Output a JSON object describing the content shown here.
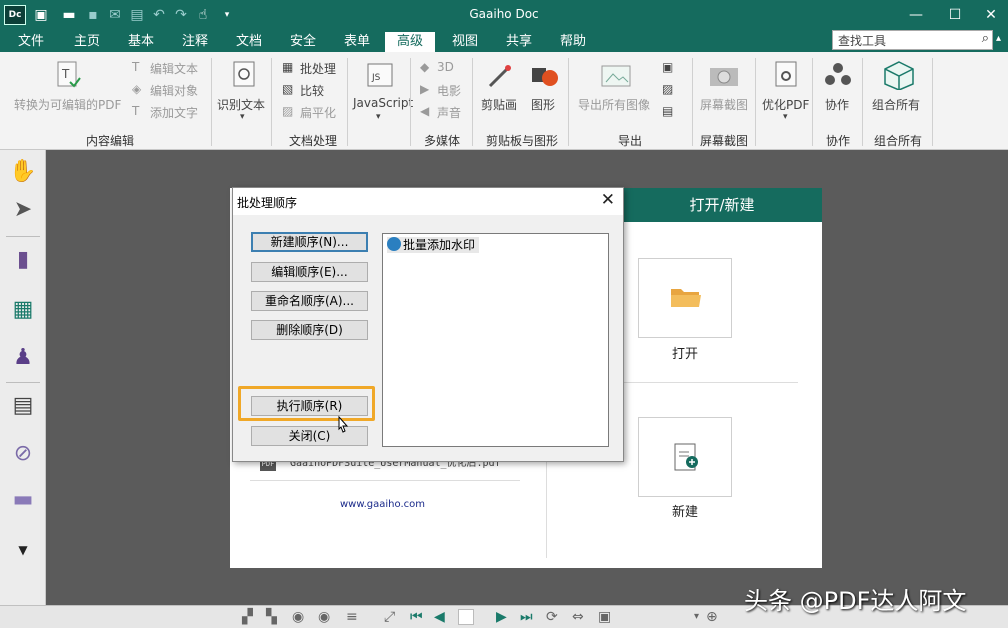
{
  "app": {
    "logo": "Dc",
    "title": "Gaaiho Doc"
  },
  "window_controls": {
    "minimize": "—",
    "maximize": "☐",
    "close": "✕"
  },
  "menu": [
    {
      "label": "文件"
    },
    {
      "label": "主页"
    },
    {
      "label": "基本"
    },
    {
      "label": "注释"
    },
    {
      "label": "文档"
    },
    {
      "label": "安全"
    },
    {
      "label": "表单"
    },
    {
      "label": "高级",
      "active": true
    },
    {
      "label": "视图"
    },
    {
      "label": "共享"
    },
    {
      "label": "帮助"
    }
  ],
  "search": {
    "placeholder": "查找工具",
    "icon": "search-icon"
  },
  "ribbon": {
    "content_edit": {
      "convert": "转换为可编辑的PDF",
      "edit_text": "编辑文本",
      "edit_object": "编辑对象",
      "add_text": "添加文字",
      "group": "内容编辑"
    },
    "ocr": {
      "label": "识别文本"
    },
    "doc_processing": {
      "batch": "批处理",
      "compare": "比较",
      "flatten": "扁平化",
      "group": "文档处理"
    },
    "javascript": {
      "label": "JavaScript"
    },
    "multimedia": {
      "d3": "3D",
      "movie": "电影",
      "sound": "声音",
      "group": "多媒体"
    },
    "clipboard": {
      "clipboard_label": "剪贴画",
      "shapes_label": "图形",
      "group": "剪贴板与图形"
    },
    "export": {
      "export_images": "导出所有图像",
      "group": "导出"
    },
    "screenshot": {
      "label": "屏幕截图",
      "group": "屏幕截图"
    },
    "optimize": {
      "label": "优化PDF"
    },
    "collab": {
      "label": "协作",
      "group": "协作"
    },
    "combine": {
      "label": "组合所有",
      "group": "组合所有"
    }
  },
  "start_page": {
    "header": "打开/新建",
    "open_label": "打开",
    "new_label": "新建",
    "recent_file": "GaaihoPDFSuite_UserManual_优化后.pdf",
    "url": "www.gaaiho.com"
  },
  "dialog": {
    "title": "批处理顺序",
    "buttons": {
      "new_sequence": "新建顺序(N)...",
      "edit_sequence": "编辑顺序(E)...",
      "rename_sequence": "重命名顺序(A)...",
      "delete_sequence": "删除顺序(D)",
      "run_sequence": "执行顺序(R)",
      "close": "关闭(C)"
    },
    "sequences": [
      "批量添加水印"
    ]
  },
  "watermark": "头条 @PDF达人阿文",
  "colors": {
    "accent": "#156b5e",
    "highlight": "#f0a828"
  }
}
